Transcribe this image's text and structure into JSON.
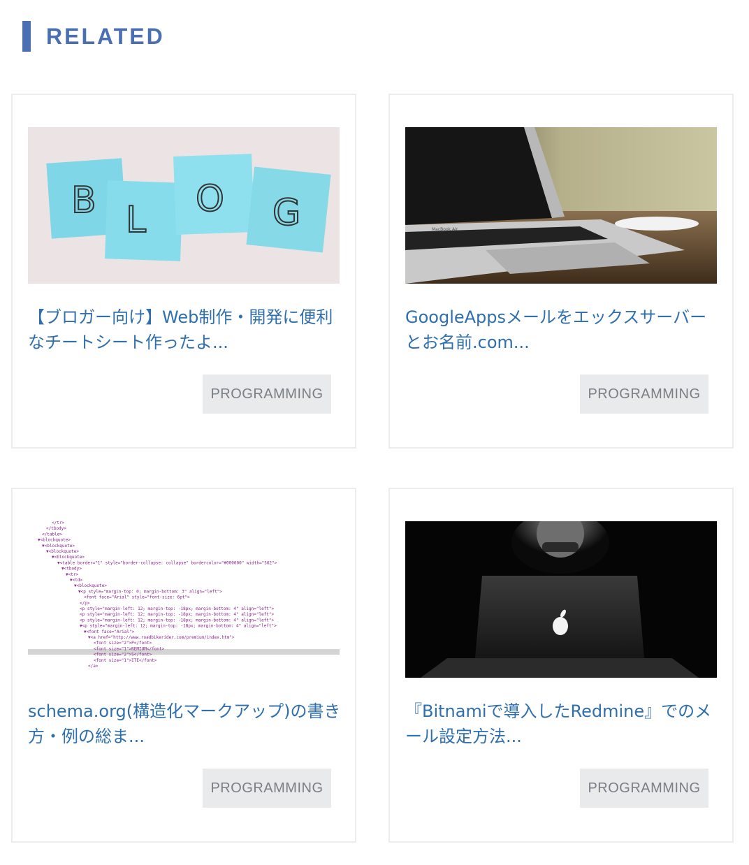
{
  "section": {
    "title": "RELATED"
  },
  "cards": [
    {
      "title": "【ブロガー向け】Web制作・開発に便利なチートシート作ったよ...",
      "category": "PROGRAMMING",
      "image": "blog-sticky-notes"
    },
    {
      "title": "GoogleAppsメールをエックスサーバーとお名前.com...",
      "category": "PROGRAMMING",
      "image": "laptop-desk"
    },
    {
      "title": "schema.org(構造化マークアップ)の書き方・例の総ま...",
      "category": "PROGRAMMING",
      "image": "html-code-tree"
    },
    {
      "title": "『Bitnamiで導入したRedmine』でのメール設定方法...",
      "category": "PROGRAMMING",
      "image": "person-macbook-dark"
    }
  ],
  "thumbnails": {
    "blog_letters": [
      "B",
      "L",
      "O",
      "G"
    ],
    "laptop_brand": "MacBook Air",
    "code_lines": [
      "</tr>",
      "</tbody>",
      "</table>",
      "▼<blockquote>",
      "▼<blockquote>",
      "▼<blockquote>",
      "▼<blockquote>",
      "▼<table border=\"1\" style=\"border-collapse: collapse\" bordercolor=\"#000000\" width=\"562\">",
      "▼<tbody>",
      "▼<tr>",
      "▼<td>",
      "▼<blockquote>",
      "▼<p style=\"margin-top: 0; margin-bottom: 3\" align=\"left\">",
      "<font face=\"Arial\" style=\"font-size: 6pt\">",
      "</p>",
      "<p style=\"margin-left: 12; margin-top: -18px; margin-bottom: 4\" align=\"left\">",
      "<p style=\"margin-left: 12; margin-top: -18px; margin-bottom: 4\" align=\"left\">",
      "<p style=\"margin-left: 12; margin-top: -18px; margin-bottom: 4\" align=\"left\">",
      "▼<p style=\"margin-left: 12; margin-top: -18px; margin-bottom: 4\" align=\"left\">",
      "▼<font face=\"Arial\">",
      "▼<a href=\"http://www.roadbikerider.com/premium/index.htm\">",
      "<font size=\"2\">P</font>",
      "<font size=\"1\">REMIUM</font>",
      "<font size=\"2\">S</font>",
      "<font size=\"1\">ITE</font>",
      "</a>"
    ]
  }
}
